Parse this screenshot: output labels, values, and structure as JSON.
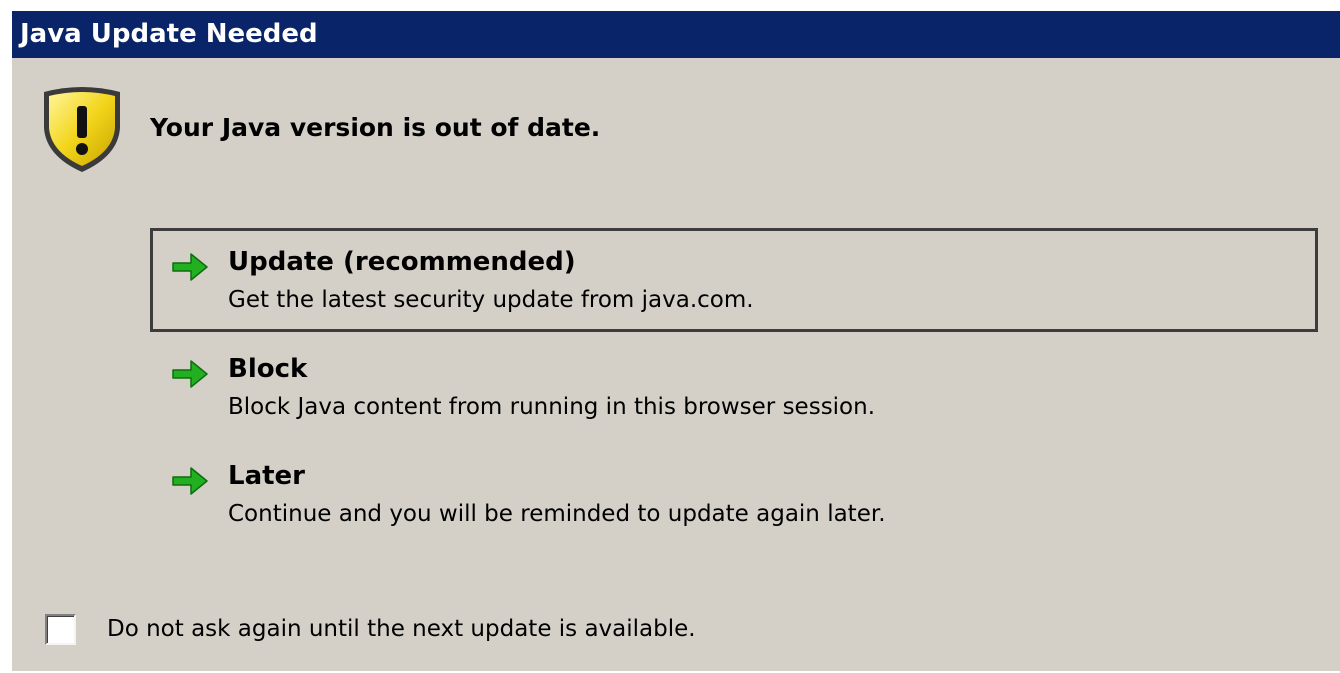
{
  "window": {
    "title": "Java Update Needed"
  },
  "message": {
    "headline": "Your Java version is out of date.",
    "icon": "warning-shield-icon"
  },
  "options": [
    {
      "title": "Update (recommended)",
      "description": "Get the latest security update from java.com.",
      "icon": "green-arrow-icon",
      "focused": true
    },
    {
      "title": "Block",
      "description": "Block Java content from running in this browser session.",
      "icon": "green-arrow-icon",
      "focused": false
    },
    {
      "title": "Later",
      "description": "Continue and you will be reminded to update again later.",
      "icon": "green-arrow-icon",
      "focused": false
    }
  ],
  "checkbox": {
    "label": "Do not ask again until the next update is available.",
    "checked": false
  },
  "colors": {
    "titlebar": "#0a246a",
    "dialog_background": "#d4d0c8",
    "arrow": "#22b022",
    "shield": "#f2d51b"
  }
}
